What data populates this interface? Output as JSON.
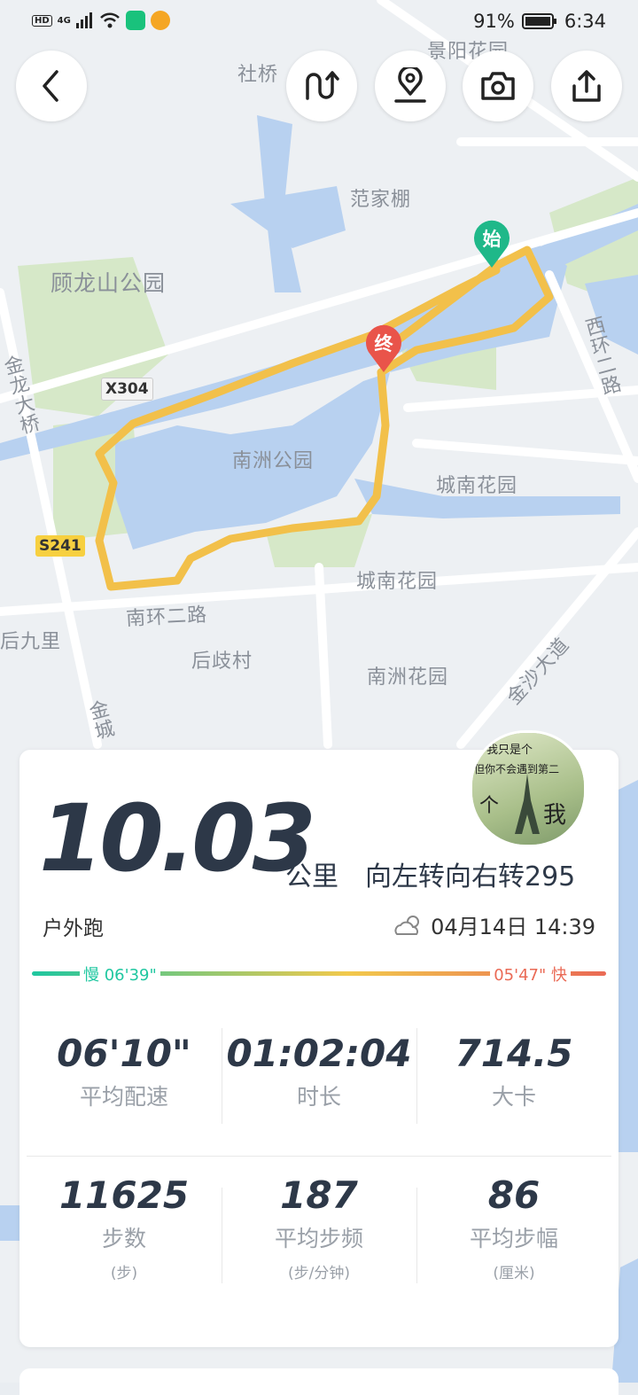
{
  "status_bar": {
    "left_labels": [
      "HD",
      "4G"
    ],
    "battery": "91%",
    "time": "6:34"
  },
  "map": {
    "labels": [
      "社桥",
      "景阳花园",
      "范家棚",
      "顾龙山公园",
      "X304",
      "金龙大桥",
      "南洲公园",
      "城南花园",
      "城南花园",
      "S241",
      "南环二路",
      "后九里",
      "后歧村",
      "南洲花园",
      "金沙大道",
      "西环二路",
      "金城"
    ],
    "start_marker": "始",
    "end_marker": "终"
  },
  "toolbar": {
    "back_icon": "chevron-left-icon",
    "route_icon": "route-icon",
    "location_icon": "location-pin-icon",
    "camera_icon": "camera-icon",
    "share_icon": "share-icon"
  },
  "summary": {
    "distance": "10.03",
    "distance_unit": "公里",
    "turns_text": "向左转向右转295",
    "activity_type": "户外跑",
    "datetime": "04月14日 14:39",
    "avatar_text_1": "我只是个",
    "avatar_text_2": "但你不会遇到第二",
    "avatar_text_3": "个",
    "avatar_text_4": "我"
  },
  "pace_range": {
    "slow_label": "慢 06'39\"",
    "fast_label": "05'47\" 快",
    "colors": [
      "#1fc7a0",
      "#f2c94c",
      "#ea6a55"
    ]
  },
  "stats": [
    {
      "value": "06'10\"",
      "label": "平均配速",
      "unit": ""
    },
    {
      "value": "01:02:04",
      "label": "时长",
      "unit": ""
    },
    {
      "value": "714.5",
      "label": "大卡",
      "unit": ""
    },
    {
      "value": "11625",
      "label": "步数",
      "unit": "(步)"
    },
    {
      "value": "187",
      "label": "平均步频",
      "unit": "(步/分钟)"
    },
    {
      "value": "86",
      "label": "平均步幅",
      "unit": "(厘米)"
    }
  ]
}
